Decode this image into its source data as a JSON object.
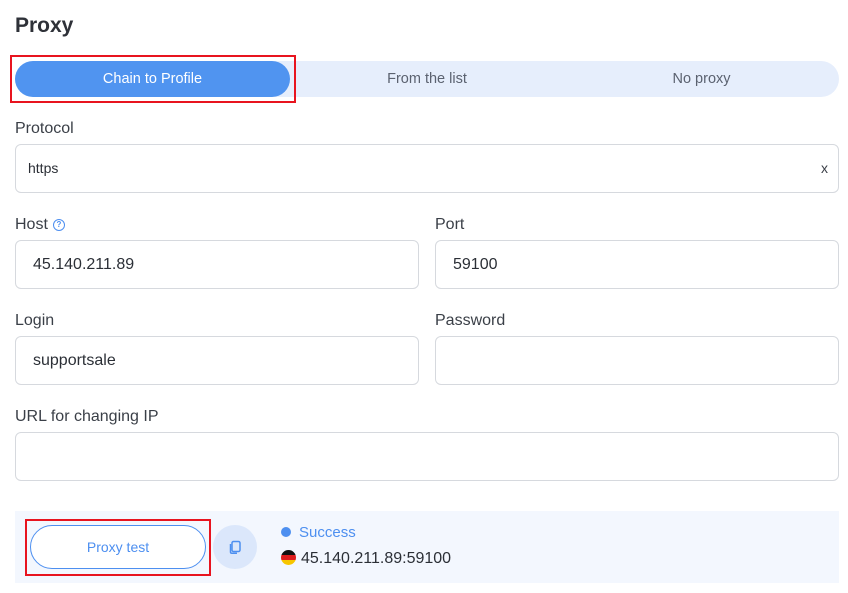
{
  "page": {
    "title": "Proxy"
  },
  "modes": {
    "items": [
      {
        "label": "Chain to Profile",
        "active": true
      },
      {
        "label": "From the list",
        "active": false
      },
      {
        "label": "No proxy",
        "active": false
      }
    ]
  },
  "form": {
    "protocol": {
      "label": "Protocol",
      "value": "https",
      "clear": "x"
    },
    "host": {
      "label": "Host",
      "value": "45.140.211.89",
      "help_icon": "question-circle-icon"
    },
    "port": {
      "label": "Port",
      "value": "59100"
    },
    "login": {
      "label": "Login",
      "value": "supportsale"
    },
    "password": {
      "label": "Password",
      "value": ""
    },
    "change_ip_url": {
      "label": "URL for changing IP",
      "value": ""
    }
  },
  "test": {
    "button_label": "Proxy test",
    "copy_icon": "copy-icon",
    "status": "Success",
    "status_color": "#4d8ff0",
    "flag_icon": "germany-flag-icon",
    "address": "45.140.211.89:59100"
  },
  "colors": {
    "accent": "#5094f0",
    "segment_bg": "#e6eefc",
    "highlight": "#e8141f"
  }
}
